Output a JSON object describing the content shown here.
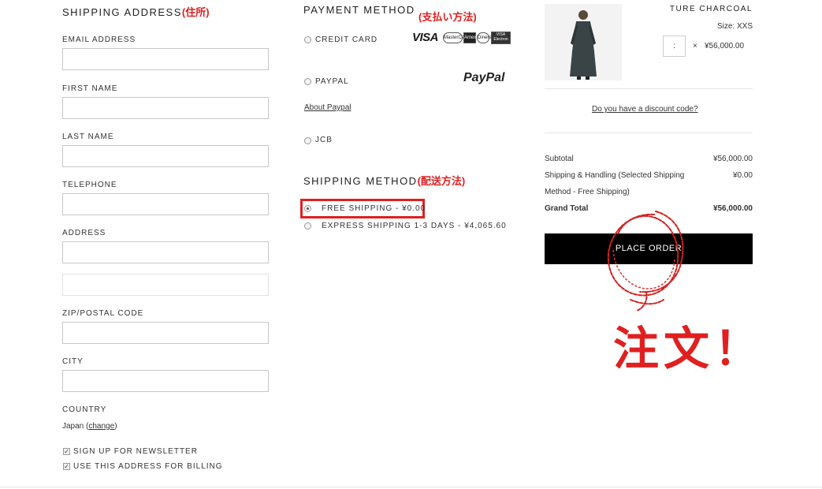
{
  "shipping_address": {
    "title": "SHIPPING ADDRESS",
    "annotation": "(住所)",
    "email_label": "EMAIL ADDRESS",
    "first_name_label": "FIRST NAME",
    "last_name_label": "LAST NAME",
    "telephone_label": "TELEPHONE",
    "address_label": "ADDRESS",
    "zip_label": "ZIP/POSTAL CODE",
    "city_label": "CITY",
    "country_label": "COUNTRY",
    "country_value": "Japan",
    "change_open": "(",
    "change_link": "change",
    "change_close": ")",
    "newsletter_label": "SIGN UP FOR NEWSLETTER",
    "newsletter_checked": true,
    "billing_label": "USE THIS ADDRESS FOR BILLING",
    "billing_checked": true
  },
  "payment_method": {
    "title": "PAYMENT METHOD",
    "annotation": "(支払い方法)",
    "credit_card_label": "CREDIT CARD",
    "visa_text": "VISA",
    "card_logos": [
      "MasterCard",
      "Amex",
      "Diners",
      "VISA Electron"
    ],
    "paypal_label": "PAYPAL",
    "paypal_logo": "PayPal",
    "about_paypal_link": "About Paypal",
    "jcb_label": "JCB"
  },
  "shipping_method": {
    "title": "SHIPPING METHOD",
    "annotation": "(配送方法)",
    "free_label": "FREE SHIPPING - ¥0.00",
    "free_selected": true,
    "express_label": "EXPRESS SHIPPING 1-3 DAYS - ¥4,065.60"
  },
  "order_summary": {
    "product_name": "TURE CHARCOAL",
    "size_text": "Size: XXS",
    "quantity_value": ":",
    "times_sign": "×",
    "price": "¥56,000.00",
    "discount_link": "Do you have a discount code?",
    "subtotal_label": "Subtotal",
    "subtotal_value": "¥56,000.00",
    "shipping_label_line1": "Shipping & Handling (Selected Shipping",
    "shipping_label_line2": "Method - Free Shipping)",
    "shipping_value": "¥0.00",
    "grand_total_label": "Grand Total",
    "grand_total_value": "¥56,000.00",
    "place_order_label": "PLACE ORDER",
    "order_annotation": "注文！"
  },
  "colors": {
    "annotation_red": "#e02020",
    "button_bg": "#000000"
  }
}
